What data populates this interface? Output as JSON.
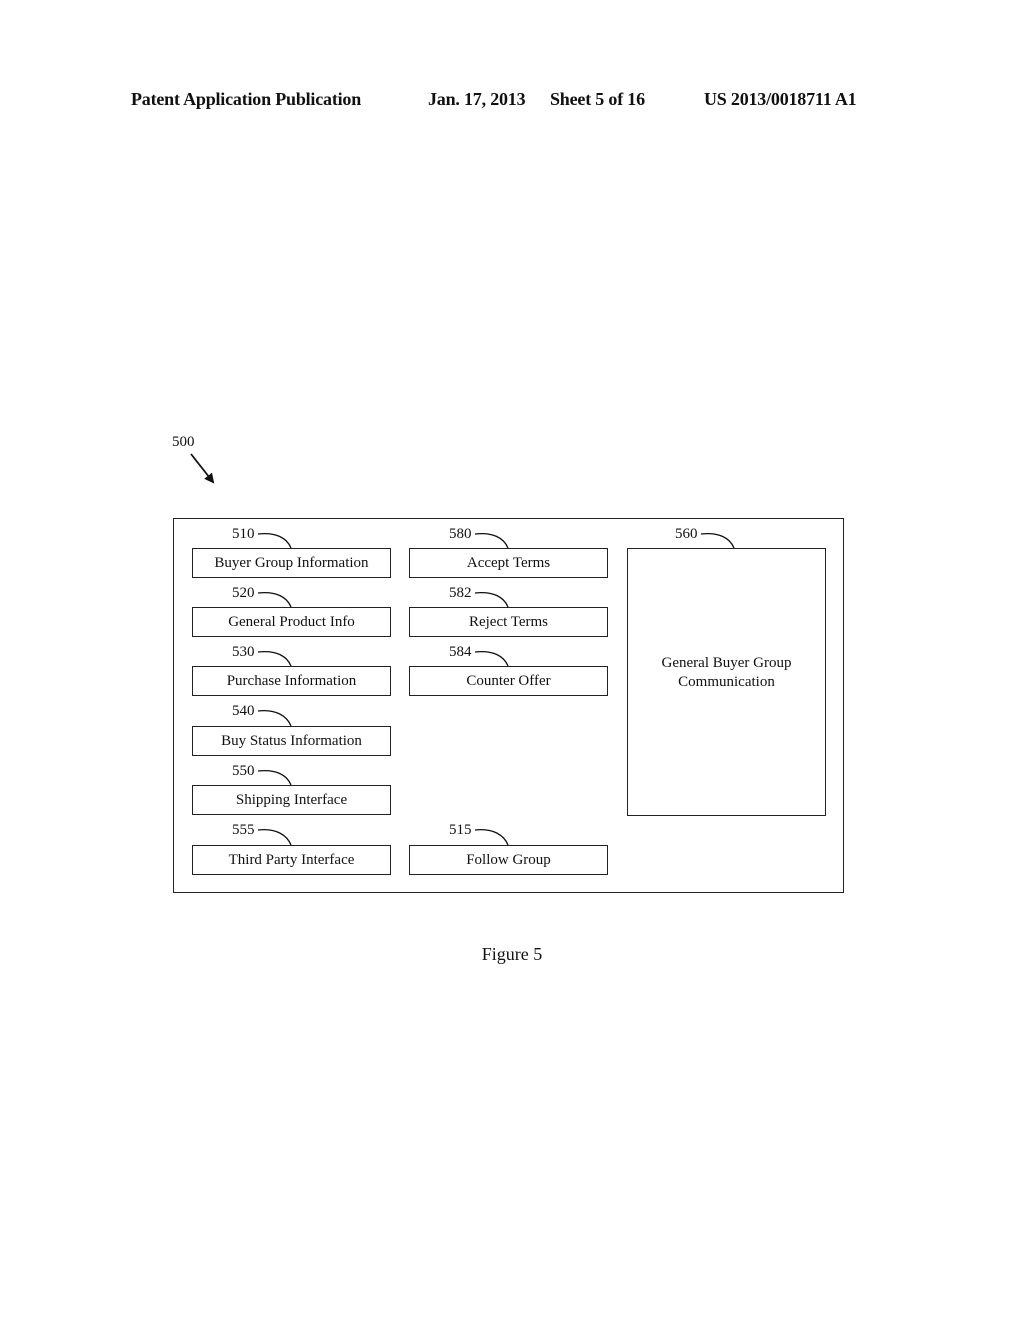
{
  "header": {
    "publication": "Patent Application Publication",
    "date": "Jan. 17, 2013",
    "sheet": "Sheet 5 of 16",
    "number": "US 2013/0018711 A1"
  },
  "figure": {
    "ref": "500",
    "caption": "Figure 5",
    "left_column": [
      {
        "ref": "510",
        "label": "Buyer Group Information"
      },
      {
        "ref": "520",
        "label": "General Product Info"
      },
      {
        "ref": "530",
        "label": "Purchase Information"
      },
      {
        "ref": "540",
        "label": "Buy Status Information"
      },
      {
        "ref": "550",
        "label": "Shipping Interface"
      },
      {
        "ref": "555",
        "label": "Third Party Interface"
      }
    ],
    "middle_column": [
      {
        "ref": "580",
        "label": "Accept Terms"
      },
      {
        "ref": "582",
        "label": "Reject Terms"
      },
      {
        "ref": "584",
        "label": "Counter Offer"
      },
      {
        "ref": "515",
        "label": "Follow Group"
      }
    ],
    "communication_panel": {
      "ref": "560",
      "label": "General Buyer Group\nCommunication"
    }
  }
}
